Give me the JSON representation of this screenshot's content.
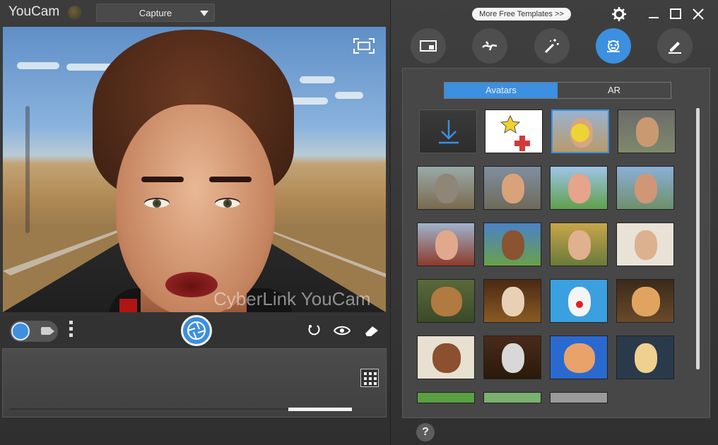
{
  "app": {
    "title": "YouCam"
  },
  "capture_mode": {
    "selected": "Capture"
  },
  "preview": {
    "watermark": "CyberLink YouCam"
  },
  "header": {
    "more_templates": "More Free Templates  >>"
  },
  "panel": {
    "tabs": [
      {
        "label": "Avatars",
        "active": true
      },
      {
        "label": "AR",
        "active": false
      }
    ]
  },
  "tool_tabs": [
    {
      "name": "frames-icon"
    },
    {
      "name": "particles-icon"
    },
    {
      "name": "effects-icon"
    },
    {
      "name": "avatars-icon",
      "active": true
    },
    {
      "name": "edit-icon"
    }
  ],
  "help": {
    "label": "?"
  },
  "colors": {
    "accent": "#3d8fe0",
    "panel_bg": "#474747",
    "window_bg": "#3a3a3a"
  }
}
